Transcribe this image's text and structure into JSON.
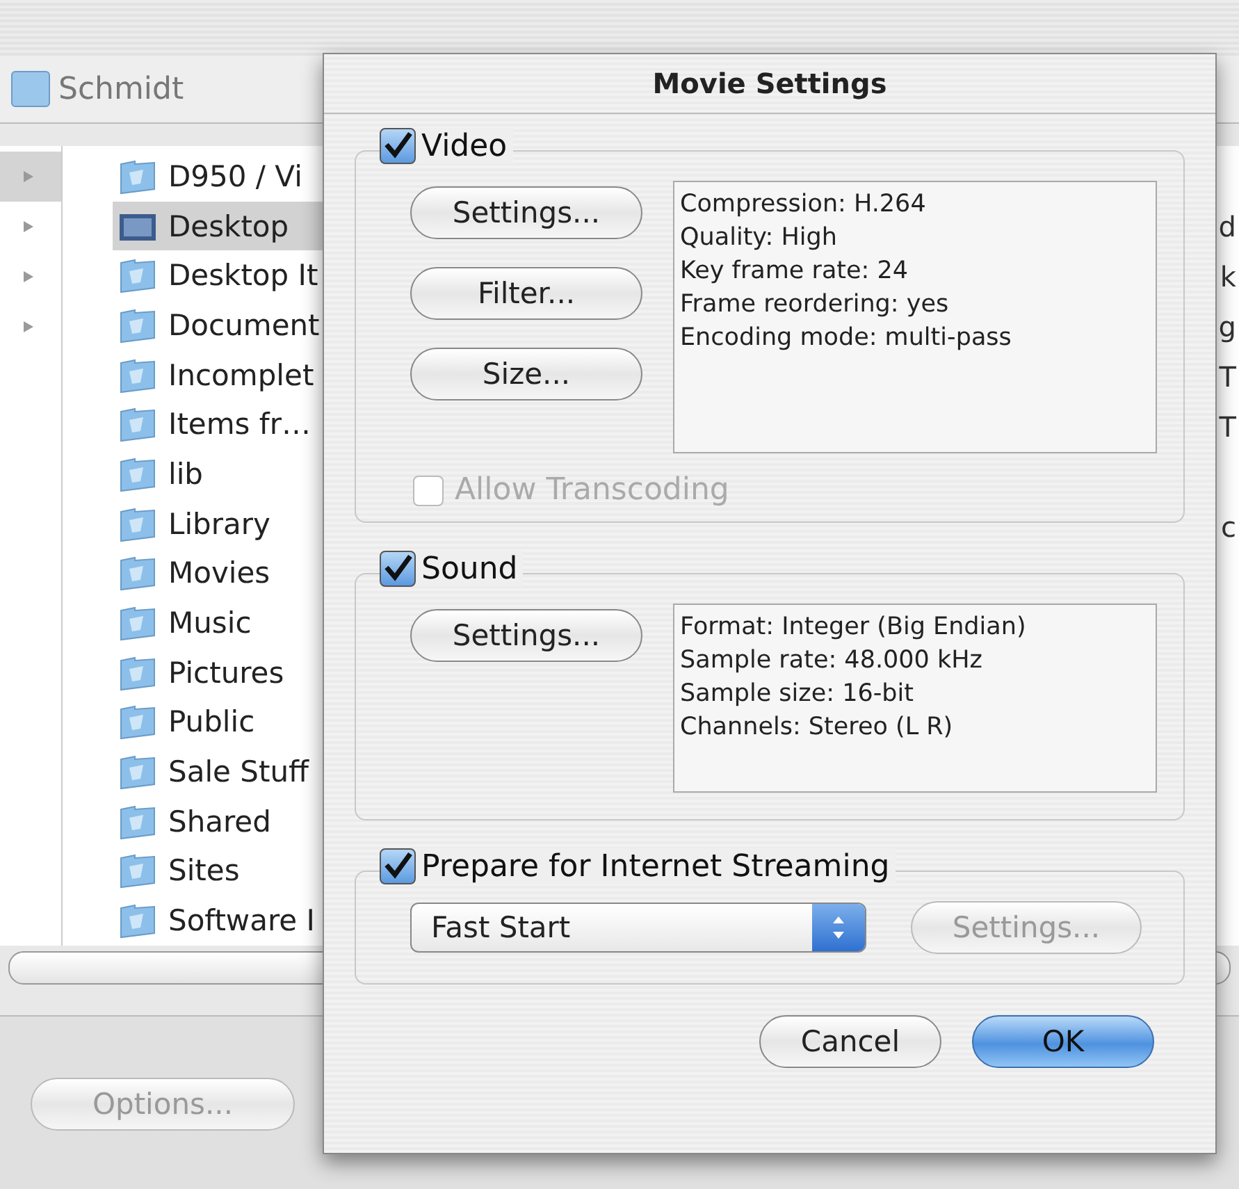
{
  "background_window": {
    "path": "Schmidt",
    "column_1": [
      {
        "selected": true
      },
      {
        "selected": false
      },
      {
        "selected": false
      },
      {
        "selected": false
      }
    ],
    "folders": [
      {
        "name": "D950 / Vi",
        "selected": false
      },
      {
        "name": "Desktop",
        "selected": true
      },
      {
        "name": "Desktop It",
        "selected": false
      },
      {
        "name": "Document",
        "selected": false
      },
      {
        "name": "Incomplet",
        "selected": false
      },
      {
        "name": "Items fr…",
        "selected": false
      },
      {
        "name": "lib",
        "selected": false
      },
      {
        "name": "Library",
        "selected": false
      },
      {
        "name": "Movies",
        "selected": false
      },
      {
        "name": "Music",
        "selected": false
      },
      {
        "name": "Pictures",
        "selected": false
      },
      {
        "name": "Public",
        "selected": false
      },
      {
        "name": "Sale Stuff",
        "selected": false
      },
      {
        "name": "Shared",
        "selected": false
      },
      {
        "name": "Sites",
        "selected": false
      },
      {
        "name": "Software I",
        "selected": false
      }
    ],
    "column_3": [
      "d",
      "k",
      "g",
      "T",
      "T",
      "c"
    ],
    "options_button": {
      "label": "Options...",
      "disabled": true
    }
  },
  "dialog": {
    "title": "Movie Settings",
    "video": {
      "label": "Video",
      "checked": true,
      "buttons": [
        {
          "label": "Settings..."
        },
        {
          "label": "Filter..."
        },
        {
          "label": "Size..."
        }
      ],
      "info": [
        "Compression: H.264",
        "Quality: High",
        "Key frame rate: 24",
        "Frame reordering: yes",
        "Encoding mode: multi-pass"
      ],
      "allow_transcoding": {
        "label": "Allow Transcoding",
        "checked": false,
        "disabled": true
      }
    },
    "sound": {
      "label": "Sound",
      "checked": true,
      "buttons": [
        {
          "label": "Settings..."
        }
      ],
      "info": [
        "Format: Integer (Big Endian)",
        "Sample rate: 48.000 kHz",
        "Sample size: 16-bit",
        "Channels: Stereo (L R)"
      ]
    },
    "streaming": {
      "label": "Prepare for Internet Streaming",
      "checked": true,
      "popup": "Fast Start",
      "settings_button": {
        "label": "Settings...",
        "disabled": true
      }
    },
    "buttons": [
      {
        "label": "Cancel",
        "default": false
      },
      {
        "label": "OK",
        "default": true
      }
    ]
  }
}
